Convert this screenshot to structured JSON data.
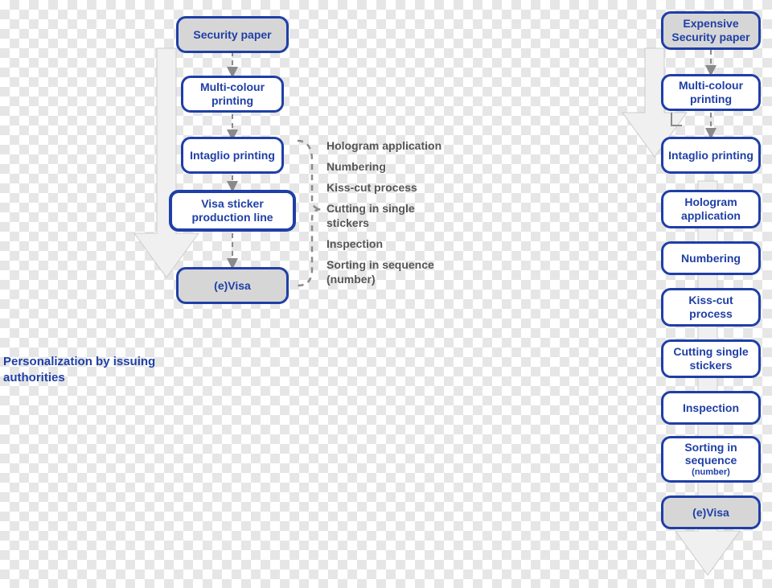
{
  "left_flow": {
    "start": "Security paper",
    "step1": "Multi-colour printing",
    "step2": "Intaglio printing",
    "step3": "Visa sticker production line",
    "end": "(e)Visa"
  },
  "left_annotations": {
    "a1": "Hologram application",
    "a2": "Numbering",
    "a3": "Kiss-cut process",
    "a4": "Cutting in single stickers",
    "a5": "Inspection",
    "a6": "Sorting in sequence (number)"
  },
  "right_flow": {
    "start": "Expensive Security paper",
    "step1": "Multi-colour printing",
    "step2": "Intaglio printing",
    "step3": "Hologram application",
    "step4": "Numbering",
    "step5": "Kiss-cut process",
    "step6": "Cutting single stickers",
    "step7": "Inspection",
    "step8_main": "Sorting in sequence",
    "step8_sub": "(number)",
    "end": "(e)Visa"
  },
  "footer": "Personalization by issuing authorities"
}
